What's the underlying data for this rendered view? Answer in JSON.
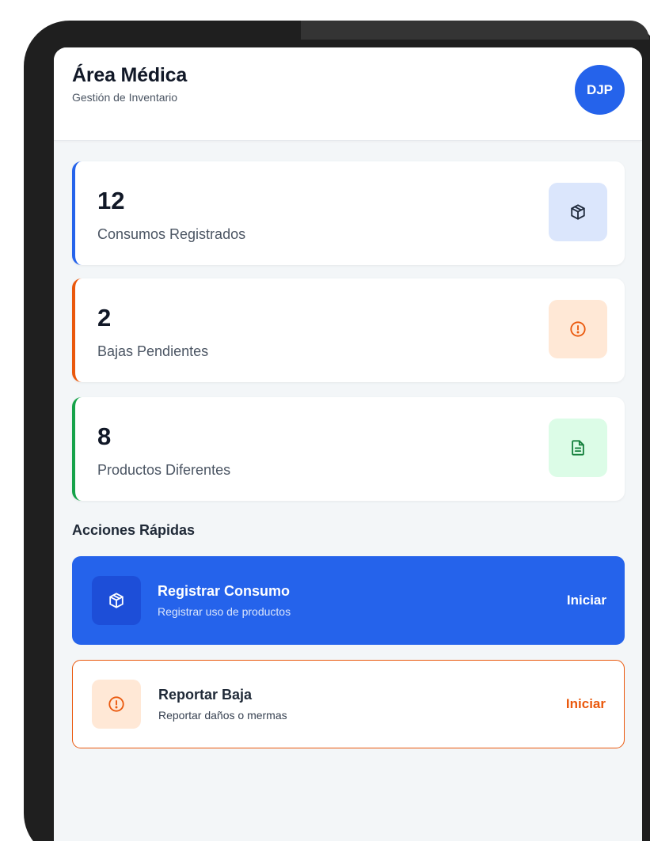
{
  "header": {
    "title": "Área Médica",
    "subtitle": "Gestión de Inventario",
    "avatar_initials": "DJP"
  },
  "stats": [
    {
      "value": "12",
      "label": "Consumos Registrados",
      "accent": "#2563eb",
      "icon_bg": "#dbe6fc",
      "icon": "package-icon"
    },
    {
      "value": "2",
      "label": "Bajas Pendientes",
      "accent": "#ea580c",
      "icon_bg": "#ffe8d6",
      "icon": "alert-circle-icon"
    },
    {
      "value": "8",
      "label": "Productos Diferentes",
      "accent": "#16a34a",
      "icon_bg": "#dcfce7",
      "icon": "document-icon"
    }
  ],
  "quick_actions": {
    "title": "Acciones Rápidas",
    "items": [
      {
        "title": "Registrar Consumo",
        "description": "Registrar uso de productos",
        "cta": "Iniciar",
        "icon": "package-icon",
        "bg": "#2563eb"
      },
      {
        "title": "Reportar Baja",
        "description": "Reportar daños o mermas",
        "cta": "Iniciar",
        "icon": "alert-circle-icon",
        "border": "#ea580c"
      }
    ]
  },
  "colors": {
    "primary": "#2563eb",
    "warning": "#ea580c",
    "success": "#16a34a",
    "background": "#f3f6f8"
  }
}
